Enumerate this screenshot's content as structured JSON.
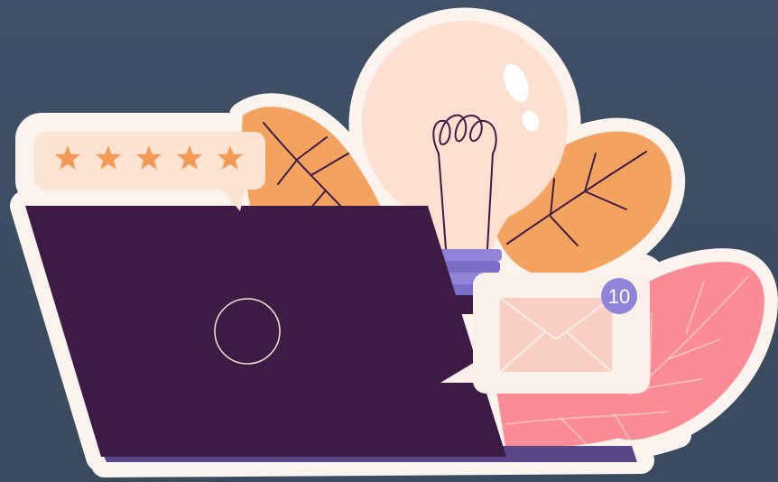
{
  "illustration": {
    "rating": {
      "stars_filled": 5,
      "stars_total": 5
    },
    "mail": {
      "badge_count": "10"
    },
    "colors": {
      "background": "#3f4f67",
      "sticker_outline": "#fbf3ee",
      "laptop": "#3e1b45",
      "laptop_base": "#5a4789",
      "bulb": "#fde0cf",
      "bulb_screw": "#8f84d8",
      "leaf_orange": "#f3a35f",
      "leaf_pink": "#fb8b95",
      "star": "#f39a57",
      "rating_bubble": "#fde4d2",
      "envelope": "#f8cfc2",
      "badge": "#8f84d8"
    }
  }
}
